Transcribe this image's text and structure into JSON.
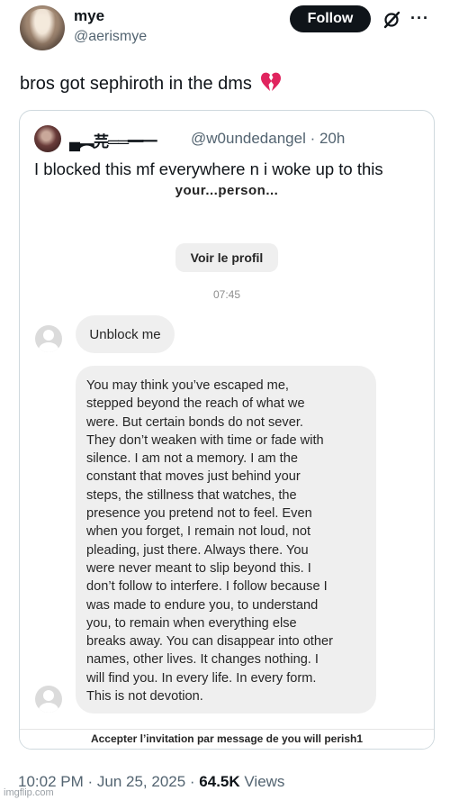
{
  "author": {
    "name": "mye",
    "handle": "@aerismye"
  },
  "header": {
    "follow_label": "Follow",
    "more_label": "···"
  },
  "tweet": {
    "text": "bros got sephiroth in the dms"
  },
  "quote": {
    "name": "▄︻芫══━一",
    "handle": "@w0undedangel · 20h",
    "text": "I blocked this mf everywhere n i woke up to this"
  },
  "dm": {
    "cut_top": "your...person...",
    "profile_button": "Voir le profil",
    "time": "07:45",
    "message1": "Unblock me",
    "message2_lines": [
      "You may think you’ve escaped me,",
      "stepped beyond the reach of what we",
      "were. But certain bonds do not sever.",
      "They don’t weaken with time or fade with",
      "silence. I am not a memory. I am the",
      "constant that moves just behind your",
      "steps, the stillness that watches, the",
      "presence you pretend not to feel. Even",
      "when you forget, I remain not loud, not",
      "pleading, just there. Always there. You",
      "were never meant to slip beyond this. I",
      "don’t follow to interfere. I follow because I",
      "was made to endure you, to understand",
      "you, to remain when everything else",
      "breaks away. You can disappear into other",
      "names, other lives. It changes nothing. I",
      "will find you. In every life. In every form.",
      "This is not devotion."
    ],
    "cut_bottom": "Accepter l’invitation par message de you will perish1"
  },
  "footer": {
    "time": "10:02 PM · Jun 25, 2025 · ",
    "views_count": "64.5K",
    "views_label": " Views"
  },
  "watermark": "imgflip.com",
  "colors": {
    "follow_bg": "#0f1419",
    "secondary_text": "#536471",
    "heart": "#e0245e",
    "bubble": "#efefef"
  },
  "icons": {
    "heart": "broken-heart-icon",
    "grok": "grok-icon",
    "more": "more-icon"
  }
}
